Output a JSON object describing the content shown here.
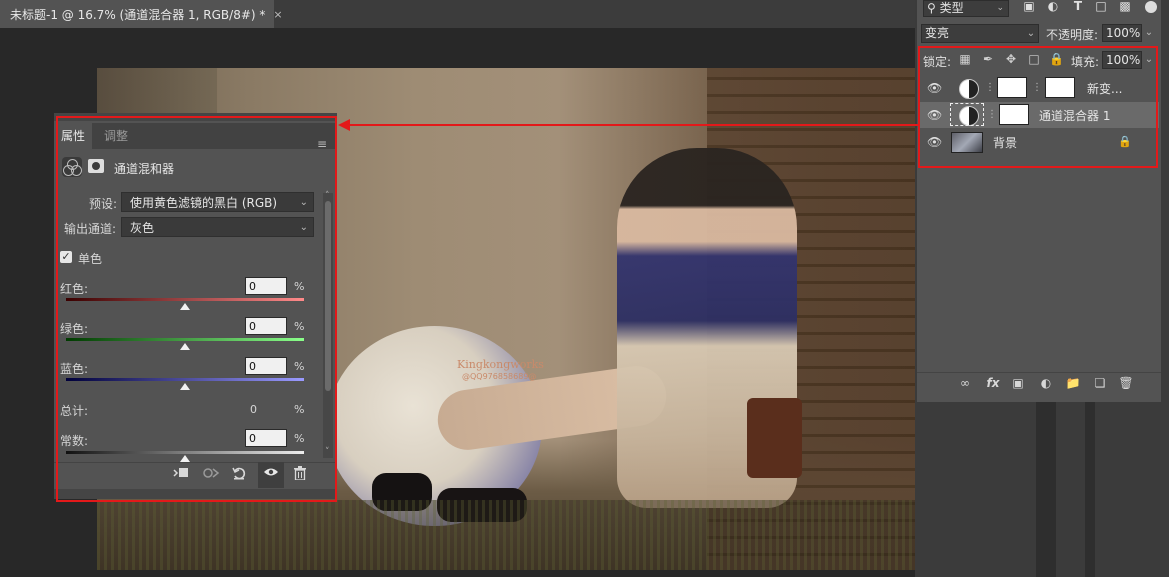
{
  "document_tab": {
    "title": "未标题-1 @ 16.7% (通道混合器 1, RGB/8#) *",
    "close": "×"
  },
  "watermark": {
    "line1": "Kingkongworks",
    "line2": "@QQ976858689@"
  },
  "properties": {
    "tabs": [
      "属性",
      "调整"
    ],
    "menu_icon": "≡",
    "title": "通道混和器",
    "preset_label": "预设:",
    "preset_value": "使用黄色滤镜的黑白 (RGB)",
    "output_label": "输出通道:",
    "output_value": "灰色",
    "monochrome_label": "单色",
    "monochrome_checked": true,
    "channels": [
      {
        "label": "红色:",
        "value": "0",
        "unit": "%",
        "color_start": "#3a0000",
        "color_end": "#ff8a8a",
        "level": 0.5
      },
      {
        "label": "绿色:",
        "value": "0",
        "unit": "%",
        "color_start": "#003a00",
        "color_end": "#8aff8a",
        "level": 0.5
      },
      {
        "label": "蓝色:",
        "value": "0",
        "unit": "%",
        "color_start": "#00003a",
        "color_end": "#9a9aff",
        "level": 0.5
      }
    ],
    "total_label": "总计:",
    "total_value": "0",
    "total_unit": "%",
    "constant_label": "常数:",
    "constant_value": "0",
    "constant_unit": "%",
    "constant_level": 0.5,
    "bottom_icons": [
      "clip-to-layer-icon",
      "view-previous-icon",
      "reset-icon",
      "visibility-icon",
      "delete-icon"
    ]
  },
  "layers": {
    "filter_label": "类型",
    "blend_mode": "变亮",
    "opacity_label": "不透明度:",
    "opacity_value": "100%",
    "lock_label": "锁定:",
    "fill_label": "填充:",
    "fill_value": "100%",
    "items": [
      {
        "name": "新变...",
        "kind": "adjustment"
      },
      {
        "name": "通道混合器 1",
        "kind": "adjustment",
        "selected": true
      },
      {
        "name": "背景",
        "kind": "image",
        "locked": true
      }
    ]
  },
  "colors": {
    "annotation": "#e3191a",
    "panel": "#535353",
    "selected_row": "#6a6a6a"
  }
}
